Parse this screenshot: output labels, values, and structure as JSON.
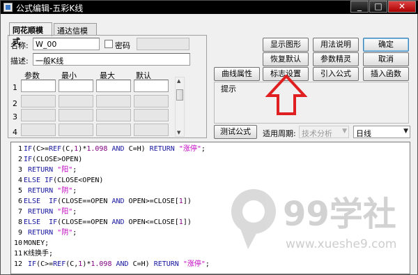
{
  "window": {
    "title": "公式编辑-五彩K线"
  },
  "titlebar_buttons": [
    "_",
    "□",
    "✕"
  ],
  "tabs": [
    {
      "label": "同花顺模式"
    },
    {
      "label": "通达信模式"
    }
  ],
  "form": {
    "name_label": "名称:",
    "name_value": "W_00",
    "password_label": "密码",
    "desc_label": "描述:",
    "desc_value": "一般K线"
  },
  "params": {
    "headers": [
      "参数",
      "最小",
      "最大",
      "默认"
    ],
    "rows": [
      "1",
      "2",
      "3",
      "4"
    ]
  },
  "buttons": {
    "show_graph": "显示图形",
    "usage": "用法说明",
    "ok": "确定",
    "restore_default": "恢复默认",
    "param_tune": "参数精灵",
    "cancel": "取消",
    "curve_props": "曲线属性",
    "mark_settings": "标志设置",
    "import_formula": "引入公式",
    "insert_func": "插入函数",
    "test_formula": "测试公式"
  },
  "hint": {
    "label": "提示"
  },
  "period": {
    "label": "适用周期:",
    "analysis_value": "技术分析",
    "period_value": "日线"
  },
  "code": {
    "lines": [
      {
        "n": "1",
        "tokens": [
          [
            "kw",
            "IF"
          ],
          [
            "cm",
            "(C>="
          ],
          [
            "kw",
            "REF"
          ],
          [
            "cm",
            "(C,"
          ],
          [
            "num",
            "1"
          ],
          [
            "cm",
            ")*"
          ],
          [
            "num",
            "1.098"
          ],
          [
            "kw",
            " AND "
          ],
          [
            "cm",
            "C=H) "
          ],
          [
            "kw",
            "RETURN"
          ],
          [
            "str",
            " \"涨停\""
          ],
          [
            "cm",
            ";"
          ]
        ]
      },
      {
        "n": "2",
        "tokens": [
          [
            "kw",
            "IF"
          ],
          [
            "cm",
            "(CLOSE>OPEN)"
          ]
        ]
      },
      {
        "n": "3",
        "tokens": [
          [
            "kw",
            " RETURN"
          ],
          [
            "str",
            " \"阳\""
          ],
          [
            "cm",
            ";"
          ]
        ]
      },
      {
        "n": "4",
        "tokens": [
          [
            "kw",
            "ELSE IF"
          ],
          [
            "cm",
            "(CLOSE<OPEN)"
          ]
        ]
      },
      {
        "n": "5",
        "tokens": [
          [
            "kw",
            " RETURN"
          ],
          [
            "str",
            " \"阴\""
          ],
          [
            "cm",
            ";"
          ]
        ]
      },
      {
        "n": "6",
        "tokens": [
          [
            "kw",
            "ELSE  IF"
          ],
          [
            "cm",
            "(CLOSE==OPEN "
          ],
          [
            "kw",
            "AND"
          ],
          [
            "cm",
            " OPEN>=CLOSE["
          ],
          [
            "num",
            "1"
          ],
          [
            "cm",
            "])"
          ]
        ]
      },
      {
        "n": "7",
        "tokens": [
          [
            "kw",
            " RETURN"
          ],
          [
            "str",
            " \"阳\""
          ],
          [
            "cm",
            ";"
          ]
        ]
      },
      {
        "n": "8",
        "tokens": [
          [
            "kw",
            "ELSE  IF"
          ],
          [
            "cm",
            "(CLOSE==OPEN "
          ],
          [
            "kw",
            "AND"
          ],
          [
            "cm",
            " OPEN<=CLOSE["
          ],
          [
            "num",
            "1"
          ],
          [
            "cm",
            "])"
          ]
        ]
      },
      {
        "n": "9",
        "tokens": [
          [
            "kw",
            " RETURN"
          ],
          [
            "str",
            " \"阴\""
          ],
          [
            "cm",
            ";"
          ]
        ]
      },
      {
        "n": "10",
        "tokens": [
          [
            "cm",
            "MONEY;"
          ]
        ]
      },
      {
        "n": "11",
        "tokens": [
          [
            "cm",
            "K线换手;"
          ]
        ]
      },
      {
        "n": "12",
        "tokens": [
          [
            "kw",
            " IF"
          ],
          [
            "cm",
            "(C>="
          ],
          [
            "kw",
            "REF"
          ],
          [
            "cm",
            "(C,"
          ],
          [
            "num",
            "1"
          ],
          [
            "cm",
            ")*"
          ],
          [
            "num",
            "1.098"
          ],
          [
            "kw",
            " AND "
          ],
          [
            "cm",
            "C=H) "
          ],
          [
            "kw",
            "RETURN"
          ],
          [
            "str",
            " \"涨停\""
          ],
          [
            "cm",
            ";"
          ]
        ]
      }
    ]
  },
  "watermark": {
    "brand": "99学社",
    "url": "www.xueshe9.com"
  },
  "colors": {
    "keyword": "#1616a0",
    "number": "#800080",
    "string": "#c000c0",
    "arrow": "#e02020"
  }
}
